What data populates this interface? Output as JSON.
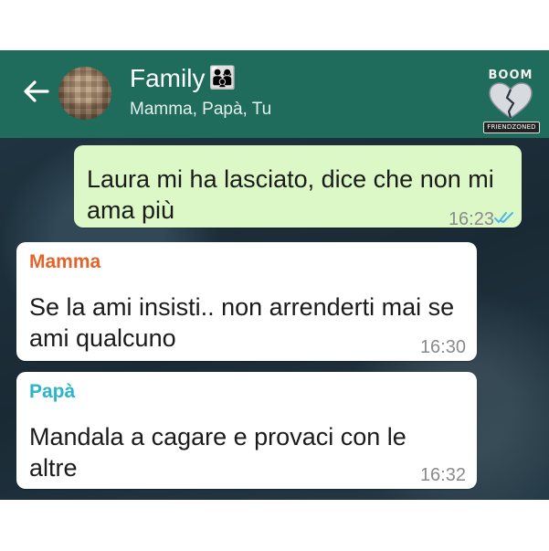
{
  "header": {
    "title": "Family",
    "title_emoji": "👨‍👩‍👦",
    "participants": "Mamma, Papà, Tu",
    "back_icon": "back-arrow-icon",
    "brand_color": "#1f6b5c"
  },
  "watermark": {
    "top_text": "BOOM",
    "bottom_text": "FRIENDZONED"
  },
  "messages": [
    {
      "direction": "outgoing",
      "text": "Laura mi ha lasciato, dice che non mi ama più",
      "time": "16:23",
      "status_icon": "double-check-read-icon"
    },
    {
      "direction": "incoming",
      "sender": "Mamma",
      "sender_color": "#e2642a",
      "text": "Se la ami insisti.. non arrenderti mai se ami qualcuno",
      "time": "16:30"
    },
    {
      "direction": "incoming",
      "sender": "Papà",
      "sender_color": "#2bb5c7",
      "text": "Mandala a cagare e provaci con le altre",
      "time": "16:32"
    }
  ]
}
